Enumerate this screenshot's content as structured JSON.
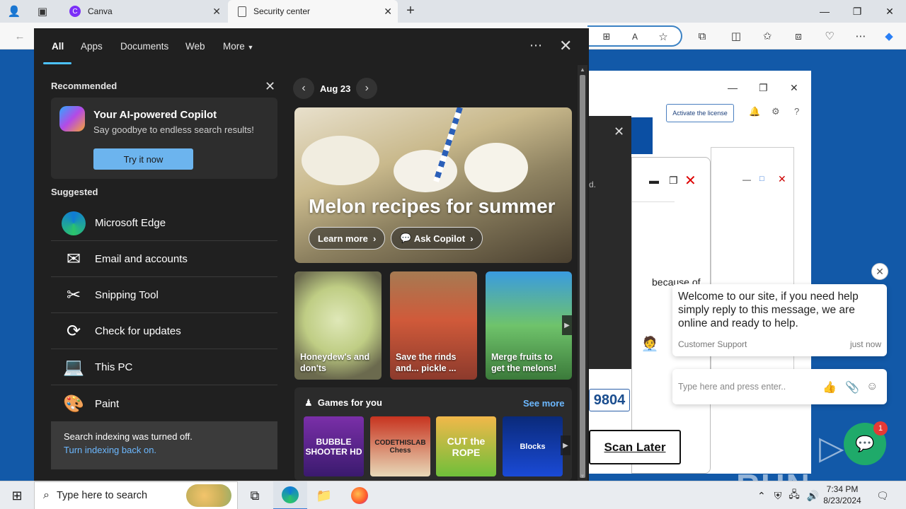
{
  "browser": {
    "tabs": [
      {
        "title": "Canva",
        "icon": "canva-icon"
      },
      {
        "title": "Security center",
        "icon": "page-icon"
      }
    ],
    "new_tab": "+",
    "window_controls": {
      "minimize": "—",
      "restore": "❐",
      "close": "✕"
    }
  },
  "background_app": {
    "activate_button": "Activate the license",
    "code_fragment": "9804",
    "scan_later": "Scan Later",
    "text_fragment": "because of",
    "d_fragment": "d."
  },
  "chat": {
    "message": "Welcome to our site, if you need help simply reply to this message, we are online and ready to help.",
    "sender": "Customer Support",
    "time": "just now",
    "input_placeholder": "Type here and press enter..",
    "badge_count": "1"
  },
  "watermark": "ANY ▷ RUN",
  "search": {
    "tabs": [
      "All",
      "Apps",
      "Documents",
      "Web",
      "More"
    ],
    "more_caret": "▼",
    "recommended_title": "Recommended",
    "copilot": {
      "title": "Your AI-powered Copilot",
      "subtitle": "Say goodbye to endless search results!",
      "button": "Try it now"
    },
    "suggested_title": "Suggested",
    "suggested": [
      {
        "label": "Microsoft Edge",
        "icon": "edge-icon"
      },
      {
        "label": "Email and accounts",
        "icon": "mail-icon"
      },
      {
        "label": "Snipping Tool",
        "icon": "snipping-tool-icon"
      },
      {
        "label": "Check for updates",
        "icon": "refresh-icon"
      },
      {
        "label": "This PC",
        "icon": "computer-icon"
      },
      {
        "label": "Paint",
        "icon": "paint-icon"
      }
    ],
    "indexing": {
      "text": "Search indexing was turned off.",
      "link": "Turn indexing back on."
    },
    "date": "Aug 23",
    "hero": {
      "title": "Melon recipes for summer",
      "learn_more": "Learn more",
      "ask_copilot": "Ask Copilot"
    },
    "cards": [
      {
        "label": "Honeydew's and don'ts"
      },
      {
        "label": "Save the rinds and... pickle ..."
      },
      {
        "label": "Merge fruits to get the melons!"
      }
    ],
    "games": {
      "title": "Games for you",
      "see_more": "See more",
      "items": [
        "BUBBLE SHOOTER HD",
        "CODETHISLAB Chess",
        "CUT the ROPE",
        "Blocks"
      ]
    }
  },
  "taskbar": {
    "search_placeholder": "Type here to search",
    "time": "7:34 PM",
    "date": "8/23/2024"
  }
}
